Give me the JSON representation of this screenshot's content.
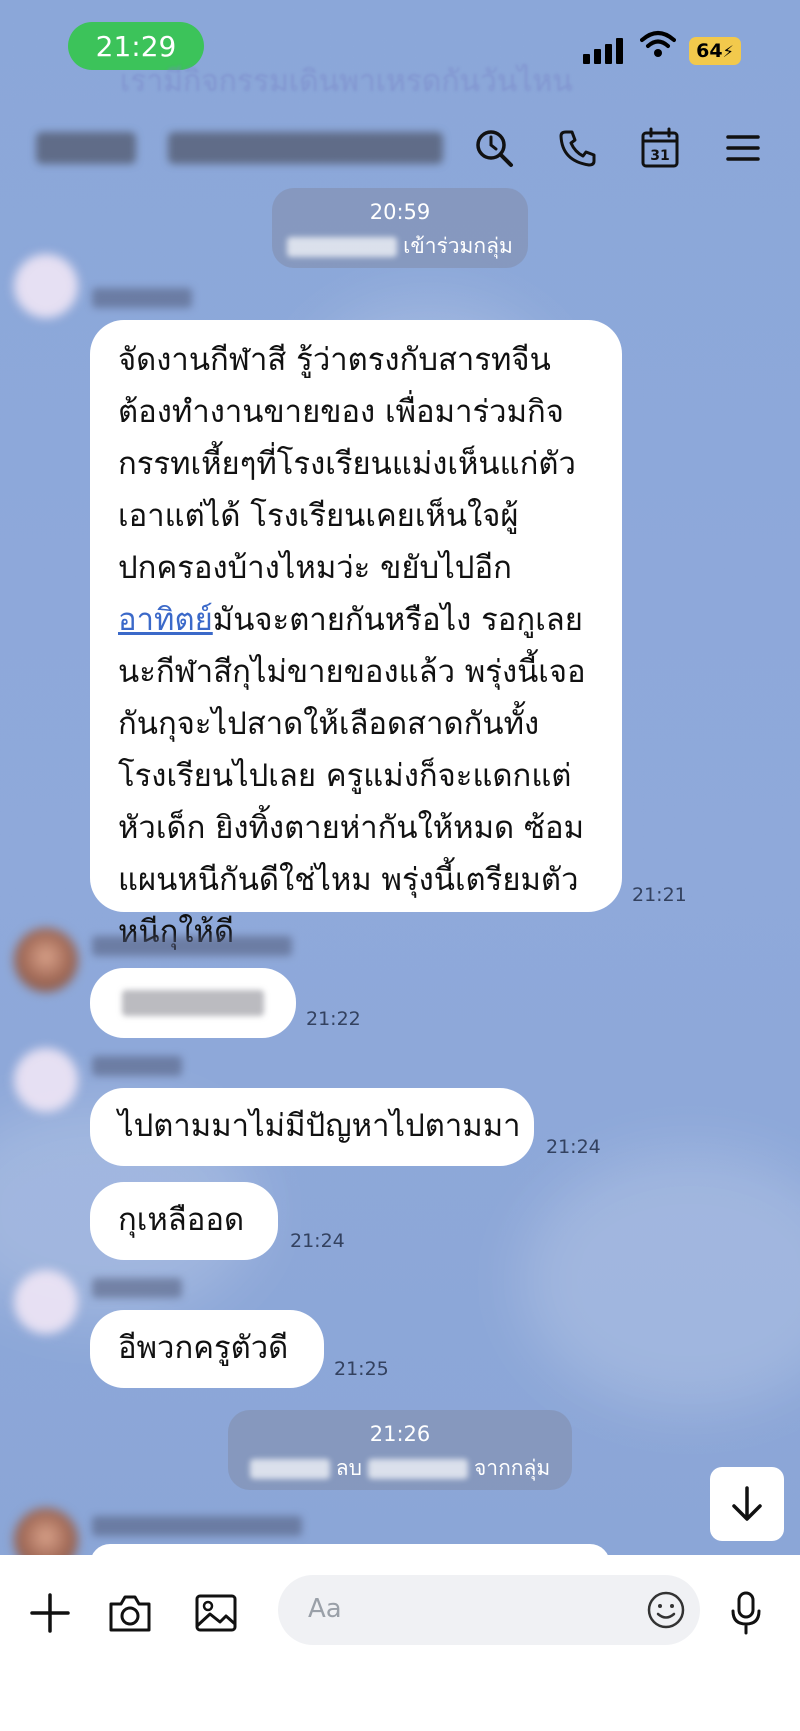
{
  "status": {
    "time": "21:29",
    "battery": "64"
  },
  "background_text": "เรามีกิจกรรมเดินพาเหรดกันวันไหน",
  "header": {
    "icons": [
      "search-icon",
      "phone-icon",
      "calendar-icon",
      "menu-icon"
    ],
    "calendar_day": "31"
  },
  "notices": [
    {
      "time": "20:59",
      "text": "เข้าร่วมกลุ่ม"
    },
    {
      "time": "21:26",
      "text_a": "ลบ",
      "text_b": "จากกลุ่ม"
    }
  ],
  "messages": [
    {
      "lines_before_link": [
        "จัดงานกีฬาสี รู้ว่าตรงกับสารทจีน",
        "ต้องทำงานขายของ เพื่อมาร่วมกิจ",
        "กรรทเหี้ยๆที่โรงเรียนแม่งเห็นแก่ตัว",
        "เอาแต่ได้ โรงเรียนเคยเห็นใจผู้",
        "ปกครองบ้างไหมว่ะ ขยับไปอีก"
      ],
      "link": "อาทิตย์",
      "link_tail": "มันจะตายกันหรือไง รอกูเลย",
      "lines_after_link": [
        "นะกีฬาสีกุไม่ขายของแล้ว พรุ่งนี้เจอ",
        "กันกุจะไปสาดให้เลือดสาดกันทั้ง",
        "โรงเรียนไปเลย ครูแม่งก็จะแดกแต่",
        "หัวเด็ก ยิงทิ้งตายห่ากันให้หมด ซ้อม",
        "แผนหนีกันดีใช่ไหม พรุ่งนี้เตรียมตัว",
        "หนีกุให้ดี"
      ],
      "time": "21:21"
    },
    {
      "time": "21:22"
    },
    {
      "text": "ไปตามมาไม่มีปัญหาไปตามมา",
      "time": "21:24"
    },
    {
      "text": "กุเหลืออด",
      "time": "21:24"
    },
    {
      "text": "อีพวกครูตัวดี",
      "time": "21:25"
    }
  ],
  "input": {
    "placeholder": "Aa"
  }
}
